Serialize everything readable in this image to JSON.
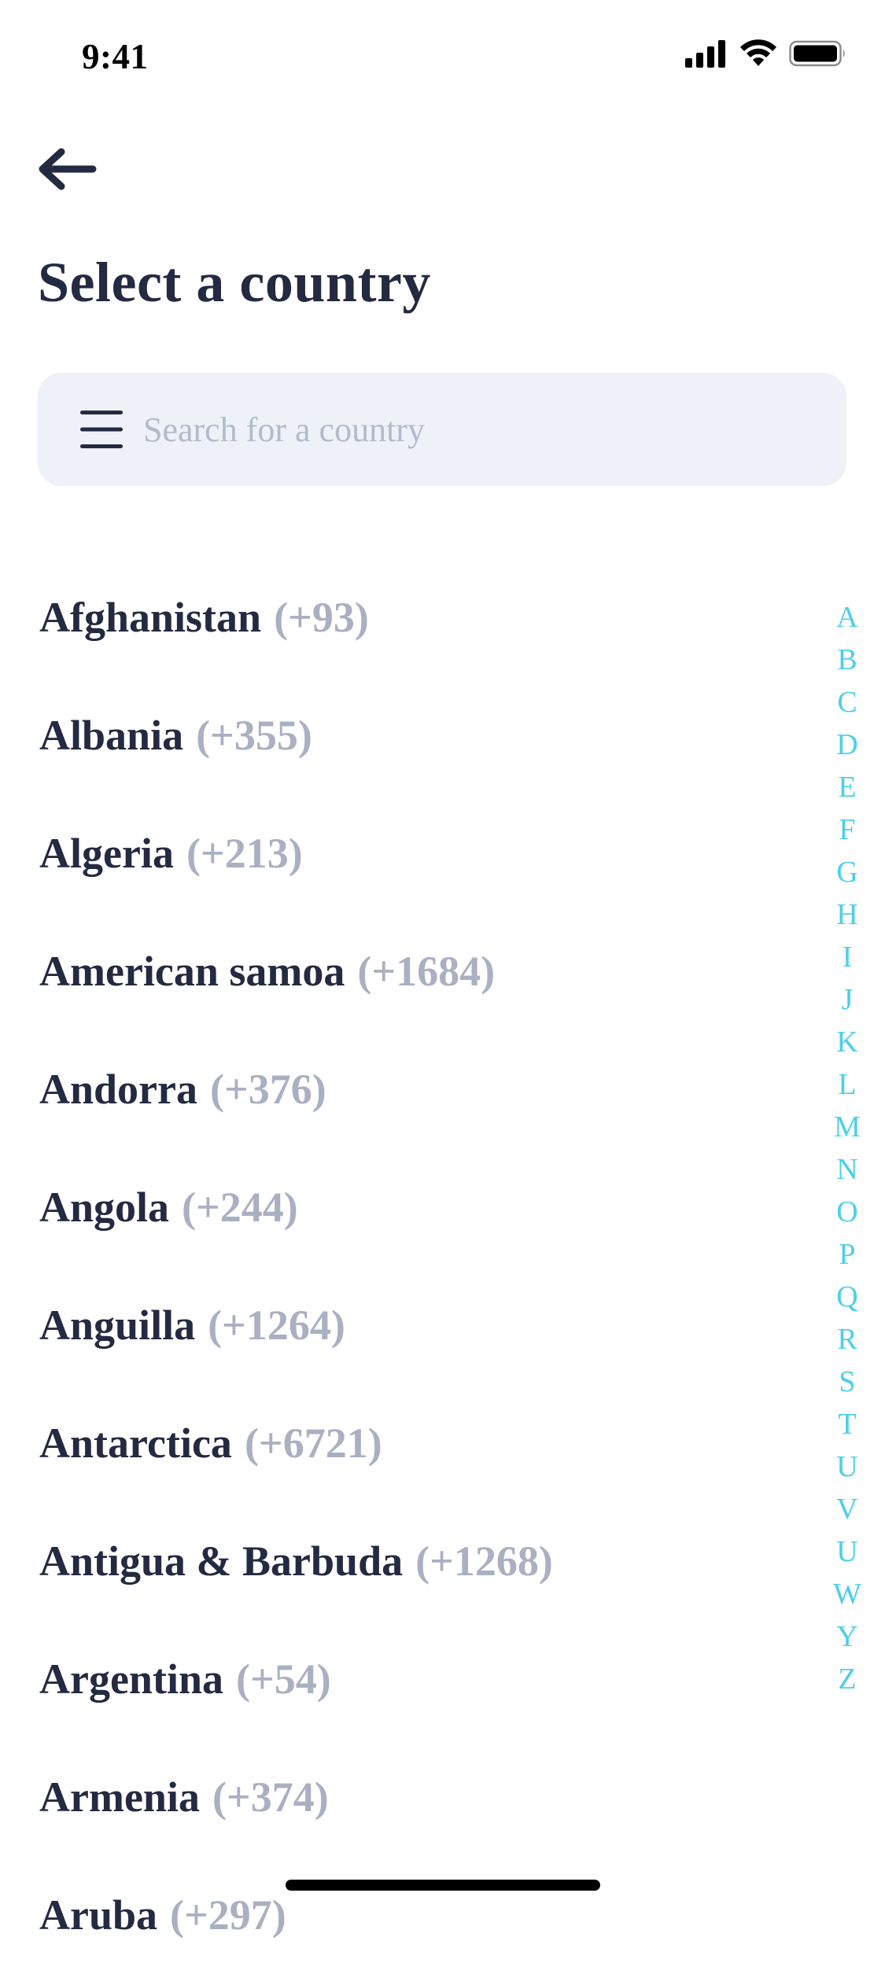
{
  "status_bar": {
    "time": "9:41"
  },
  "header": {
    "back_icon": "arrow-left-icon",
    "title": "Select a country"
  },
  "search": {
    "menu_icon": "menu-icon",
    "placeholder": "Search for a country",
    "value": ""
  },
  "countries": [
    {
      "name": "Afghanistan",
      "code": "(+93)"
    },
    {
      "name": "Albania",
      "code": "(+355)"
    },
    {
      "name": "Algeria",
      "code": "(+213)"
    },
    {
      "name": "American samoa",
      "code": "(+1684)"
    },
    {
      "name": "Andorra",
      "code": "(+376)"
    },
    {
      "name": "Angola",
      "code": "(+244)"
    },
    {
      "name": "Anguilla",
      "code": "(+1264)"
    },
    {
      "name": "Antarctica",
      "code": "(+6721)"
    },
    {
      "name": "Antigua & Barbuda",
      "code": "(+1268)"
    },
    {
      "name": "Argentina",
      "code": "(+54)"
    },
    {
      "name": "Armenia",
      "code": "(+374)"
    },
    {
      "name": "Aruba",
      "code": "(+297)"
    }
  ],
  "alphabet_index": [
    "A",
    "B",
    "C",
    "D",
    "E",
    "F",
    "G",
    "H",
    "I",
    "J",
    "K",
    "L",
    "M",
    "N",
    "O",
    "P",
    "Q",
    "R",
    "S",
    "T",
    "U",
    "V",
    "U",
    "W",
    "Y",
    "Z"
  ],
  "colors": {
    "text_primary": "#232a41",
    "text_secondary": "#aab0c2",
    "accent": "#4ccfe9",
    "search_background": "#eef1f7"
  }
}
